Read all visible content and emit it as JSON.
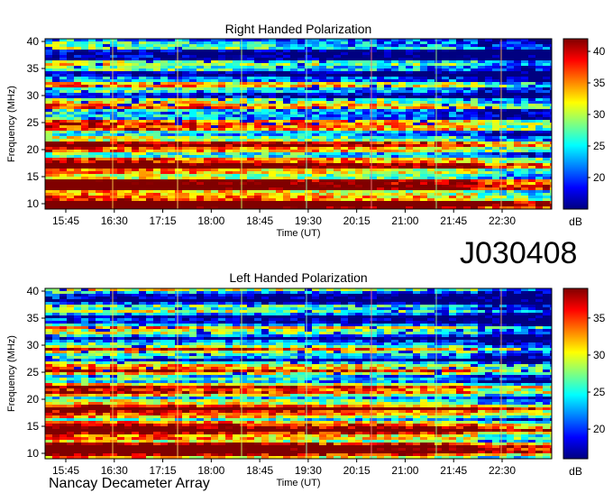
{
  "big_title": "J030408",
  "footer": "Nancay Decameter Array",
  "chart_data": [
    {
      "type": "heatmap",
      "title": "Right Handed Polarization",
      "xlabel": "Time (UT)",
      "ylabel": "Frequency (MHz)",
      "x_ticks": [
        "15:45",
        "16:30",
        "17:15",
        "18:00",
        "18:45",
        "19:30",
        "20:15",
        "21:00",
        "21:45",
        "22:30"
      ],
      "y_ticks": [
        10,
        15,
        20,
        25,
        30,
        35,
        40
      ],
      "ylim": [
        9,
        40.5
      ],
      "colorbar": {
        "label": "dB",
        "ticks": [
          20,
          25,
          30,
          35,
          40
        ],
        "range": [
          15,
          42
        ]
      }
    },
    {
      "type": "heatmap",
      "title": "Left Handed Polarization",
      "xlabel": "Time (UT)",
      "ylabel": "Frequency (MHz)",
      "x_ticks": [
        "15:45",
        "16:30",
        "17:15",
        "18:00",
        "18:45",
        "19:30",
        "20:15",
        "21:00",
        "21:45",
        "22:30"
      ],
      "y_ticks": [
        10,
        15,
        20,
        25,
        30,
        35,
        40
      ],
      "ylim": [
        9,
        40.5
      ],
      "colorbar": {
        "label": "dB",
        "ticks": [
          20,
          25,
          30,
          35
        ],
        "range": [
          16,
          39
        ]
      }
    }
  ]
}
